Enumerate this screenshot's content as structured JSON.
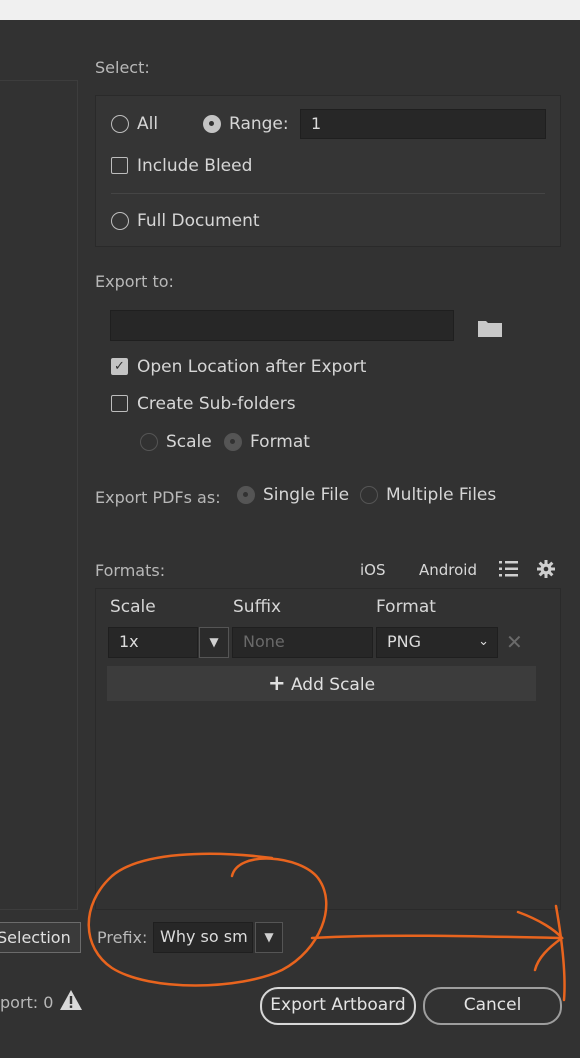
{
  "select": {
    "label": "Select:",
    "all_label": "All",
    "range_label": "Range:",
    "range_value": "1",
    "include_bleed_label": "Include Bleed",
    "full_document_label": "Full Document"
  },
  "export_to": {
    "label": "Export to:",
    "path_value": "",
    "open_location_label": "Open Location after Export",
    "create_subfolders_label": "Create Sub-folders",
    "scale_label": "Scale",
    "format_label": "Format"
  },
  "export_pdfs": {
    "label": "Export PDFs as:",
    "single_file_label": "Single File",
    "multiple_files_label": "Multiple Files"
  },
  "formats": {
    "label": "Formats:",
    "ios_label": "iOS",
    "android_label": "Android",
    "col_scale": "Scale",
    "col_suffix": "Suffix",
    "col_format": "Format",
    "row": {
      "scale": "1x",
      "suffix_placeholder": "None",
      "format": "PNG"
    },
    "add_scale_label": "Add Scale"
  },
  "left": {
    "selection_button_label": "Selection",
    "export_count_label": "port: 0"
  },
  "prefix": {
    "label": "Prefix:",
    "value": "Why so sm"
  },
  "buttons": {
    "export_label": "Export Artboard",
    "cancel_label": "Cancel"
  },
  "colors": {
    "annotation": "#e8641e",
    "background": "#323232"
  }
}
